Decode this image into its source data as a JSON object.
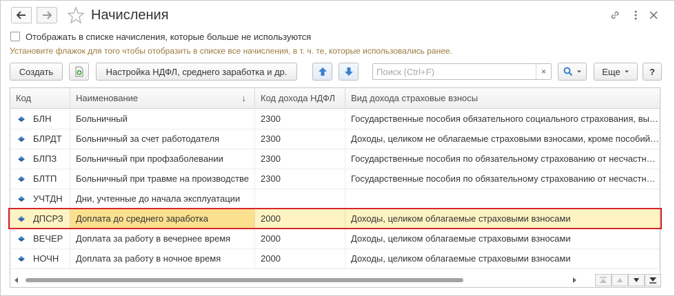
{
  "window": {
    "title": "Начисления",
    "nav_back_icon": "arrow-left-icon",
    "nav_forward_icon": "arrow-right-icon",
    "favorite_icon": "star-icon",
    "link_icon": "link-icon",
    "menu_icon": "more-vertical-icon",
    "close_icon": "close-icon"
  },
  "filter": {
    "show_unused_label": "Отображать в списке начисления, которые больше не используются",
    "show_unused_checked": false,
    "hint": "Установите флажок для того чтобы отобразить в списке все начисления, в т. ч. те, которые использовались ранее."
  },
  "toolbar": {
    "create_label": "Создать",
    "copy_icon": "add-copy-icon",
    "ndfl_settings_label": "Настройка НДФЛ, среднего заработка и др.",
    "move_up_icon": "arrow-up-icon",
    "move_down_icon": "arrow-down-icon",
    "search_placeholder": "Поиск (Ctrl+F)",
    "search_clear": "×",
    "search_icon": "search-icon",
    "more_label": "Еще",
    "help_label": "?"
  },
  "table": {
    "columns": [
      "Код",
      "Наименование",
      "Код дохода НДФЛ",
      "Вид дохода страховые взносы"
    ],
    "sort_indicator": "↓",
    "rows": [
      {
        "code": "БЛН",
        "name": "Больничный",
        "ndfl": "2300",
        "insurance": "Государственные пособия обязательного социального страхования, вы…"
      },
      {
        "code": "БЛРДТ",
        "name": "Больничный за счет работодателя",
        "ndfl": "2300",
        "insurance": "Доходы, целиком не облагаемые страховыми взносами, кроме пособий…"
      },
      {
        "code": "БЛПЗ",
        "name": "Больничный при профзаболевании",
        "ndfl": "2300",
        "insurance": "Государственные пособия по обязательному страхованию от несчастн…"
      },
      {
        "code": "БЛТП",
        "name": "Больничный при травме на производстве",
        "ndfl": "2300",
        "insurance": "Государственные пособия по обязательному страхованию от несчастн…"
      },
      {
        "code": "УЧТДН",
        "name": "Дни, учтенные до начала эксплуатации",
        "ndfl": "",
        "insurance": ""
      },
      {
        "code": "ДПСРЗ",
        "name": "Доплата до среднего заработка",
        "ndfl": "2000",
        "insurance": "Доходы, целиком облагаемые страховыми взносами",
        "selected": true
      },
      {
        "code": "ВЕЧЕР",
        "name": "Доплата за работу в вечернее время",
        "ndfl": "2000",
        "insurance": "Доходы, целиком облагаемые страховыми взносами"
      },
      {
        "code": "НОЧН",
        "name": "Доплата за работу в ночное время",
        "ndfl": "2000",
        "insurance": "Доходы, целиком облагаемые страховыми взносами"
      }
    ]
  },
  "colors": {
    "hint_text": "#9b7a3c",
    "selected_row": "#fdf3c3",
    "selected_cell": "#fbe08e",
    "selection_outline": "#d9242a",
    "accent_blue": "#3a7fd0"
  }
}
